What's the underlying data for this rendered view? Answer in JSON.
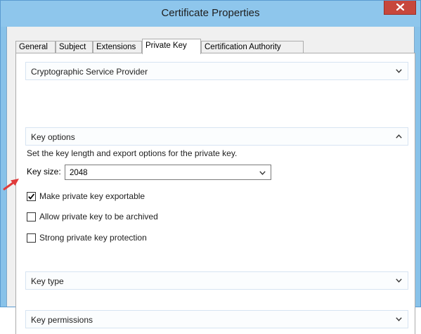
{
  "window": {
    "title": "Certificate Properties",
    "close_label": "x"
  },
  "tabs": [
    {
      "label": "General",
      "active": false
    },
    {
      "label": "Subject",
      "active": false
    },
    {
      "label": "Extensions",
      "active": false
    },
    {
      "label": "Private Key",
      "active": true
    },
    {
      "label": "Certification Authority",
      "active": false
    }
  ],
  "sections": {
    "csp": {
      "label": "Cryptographic Service Provider",
      "expanded": false
    },
    "key_options": {
      "label": "Key options",
      "expanded": true
    },
    "key_type": {
      "label": "Key type",
      "expanded": false
    },
    "key_permissions": {
      "label": "Key permissions",
      "expanded": false
    }
  },
  "key_options": {
    "description": "Set the key length and export options for the private key.",
    "key_size_label": "Key size:",
    "key_size_value": "2048",
    "checkboxes": [
      {
        "label": "Make private key exportable",
        "checked": true
      },
      {
        "label": "Allow private key to be archived",
        "checked": false
      },
      {
        "label": "Strong private key protection",
        "checked": false
      }
    ]
  },
  "colors": {
    "title_bar": "#8ec6ec",
    "close_button": "#c7473c",
    "annotation_arrow": "#e03a3a"
  }
}
